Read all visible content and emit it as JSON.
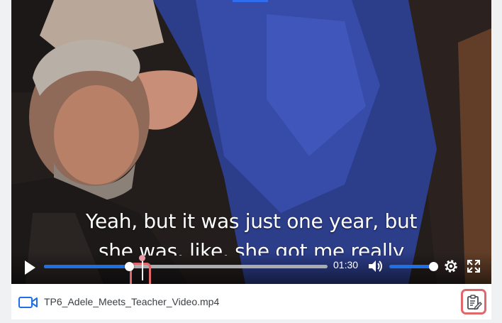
{
  "video": {
    "caption_line1": "Yeah, but it was just one year, but",
    "caption_line2": "she was, like, she got me really",
    "current_time": "01:30",
    "progress_fraction": 0.3,
    "volume_fraction": 1.0,
    "accent_color": "#1f6fe5"
  },
  "icons": {
    "play": "play-icon",
    "volume": "volume-icon",
    "settings": "gear-icon",
    "fullscreen": "fullscreen-icon",
    "file": "video-file-icon",
    "notes": "clipboard-edit-icon"
  },
  "file": {
    "name": "TP6_Adele_Meets_Teacher_Video.mp4"
  },
  "highlight_color": "#e0686a"
}
